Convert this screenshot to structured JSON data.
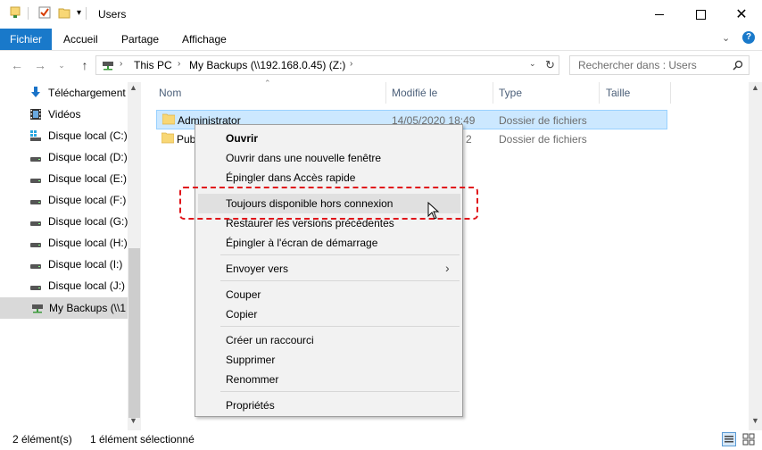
{
  "window": {
    "title": "Users"
  },
  "ribbon": {
    "tabs": [
      "Fichier",
      "Accueil",
      "Partage",
      "Affichage"
    ]
  },
  "address": {
    "segments": [
      "This PC",
      "My Backups (\\\\192.168.0.45) (Z:)"
    ],
    "search_placeholder": "Rechercher dans : Users"
  },
  "nav": {
    "items": [
      "Téléchargement",
      "Vidéos",
      "Disque local (C:)",
      "Disque local (D:)",
      "Disque local (E:)",
      "Disque local (F:)",
      "Disque local (G:)",
      "Disque local (H:)",
      "Disque local (I:)",
      "Disque local (J:)",
      "My Backups (\\\\1"
    ]
  },
  "columns": {
    "name": "Nom",
    "modified": "Modifié le",
    "type": "Type",
    "size": "Taille"
  },
  "files": [
    {
      "name": "Administrator",
      "modified": "14/05/2020 18:49",
      "type": "Dossier de fichiers"
    },
    {
      "name": "Pub",
      "modified": "2",
      "type": "Dossier de fichiers"
    }
  ],
  "context_menu": {
    "open": "Ouvrir",
    "open_new_window": "Ouvrir dans une nouvelle fenêtre",
    "pin_quick_access": "Épingler dans Accès rapide",
    "always_offline": "Toujours disponible hors connexion",
    "restore_previous": "Restaurer les versions précédentes",
    "pin_start": "Épingler à l'écran de démarrage",
    "send_to": "Envoyer vers",
    "cut": "Couper",
    "copy": "Copier",
    "create_shortcut": "Créer un raccourci",
    "delete": "Supprimer",
    "rename": "Renommer",
    "properties": "Propriétés"
  },
  "status": {
    "count": "2 élément(s)",
    "selected": "1 élément sélectionné"
  },
  "colors": {
    "accent": "#1979ca",
    "selection": "#cce8ff",
    "highlight_box": "#e0141a",
    "folder": "#f8d775"
  }
}
